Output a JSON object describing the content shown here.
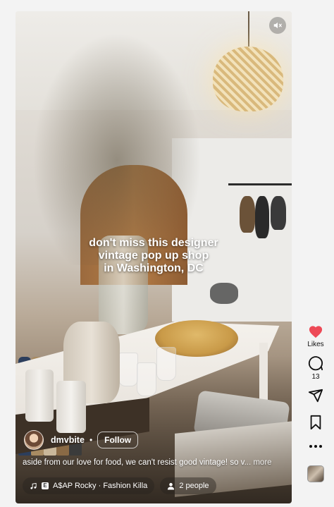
{
  "overlay": {
    "line1": "don't miss this designer",
    "line2": "vintage pop up shop",
    "line3": "in Washington, DC"
  },
  "controls": {
    "mute_icon": "speaker-muted-icon"
  },
  "author": {
    "username": "dmvbite",
    "separator": "•",
    "follow_label": "Follow"
  },
  "caption": {
    "text": "aside from our love for food, we can't resist good vintage! so v",
    "more_label": "... more"
  },
  "audio": {
    "track": "A$AP Rocky · Fashion Killa",
    "icon": "music-note-icon"
  },
  "collab": {
    "people_label": "2 people",
    "icon": "person-icon"
  },
  "actions": {
    "likes_label": "Likes",
    "comments_count": "13",
    "like_icon": "heart-icon",
    "like_color": "#ed4956",
    "comment_icon": "comment-icon",
    "share_icon": "send-icon",
    "save_icon": "bookmark-icon",
    "more_icon": "more-icon",
    "audio_thumb_icon": "audio-thumbnail"
  }
}
